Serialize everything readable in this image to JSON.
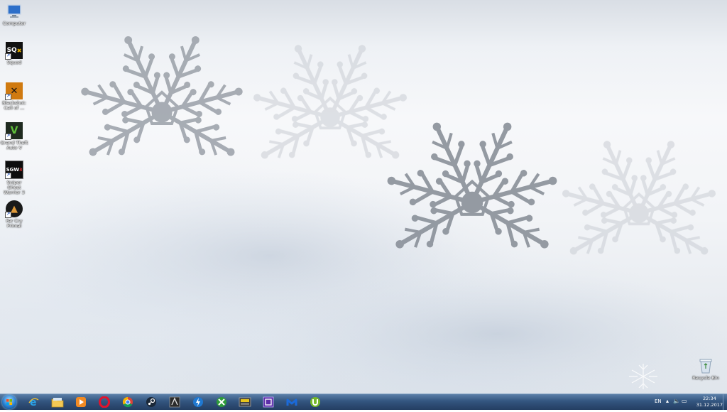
{
  "desktop": {
    "icons": [
      {
        "label": "Computer",
        "icon": "computer-icon"
      },
      {
        "label": "Squad",
        "icon": "squad-icon"
      },
      {
        "label": "Blackshot: Call of ...",
        "icon": "blackshot-icon"
      },
      {
        "label": "Grand Theft Auto V",
        "icon": "gta-v-icon"
      },
      {
        "label": "Sniper Ghost Warrior 3",
        "icon": "sniper-ghost-warrior-icon"
      },
      {
        "label": "Far Cry Primal",
        "icon": "far-cry-primal-icon"
      }
    ],
    "recycle_bin": {
      "label": "Recycle Bin",
      "icon": "recycle-bin-icon"
    },
    "watermark_icon": "snowflake-logo-icon"
  },
  "taskbar": {
    "start": "start-orb-icon",
    "apps": [
      "internet-explorer-icon",
      "file-explorer-icon",
      "media-player-icon",
      "opera-icon",
      "chrome-icon",
      "steam-icon",
      "game-app-icon",
      "blue-lightning-icon",
      "green-app-icon",
      "game-launcher-icon",
      "purple-app-icon",
      "malwarebytes-icon",
      "utorrent-icon"
    ],
    "tray": {
      "language": "EN",
      "time": "22:34",
      "date": "31.12.2017"
    }
  },
  "colors": {
    "taskbar": "#33557f",
    "snow": "#f4f6f9",
    "glitter": "#9aa0a8"
  }
}
